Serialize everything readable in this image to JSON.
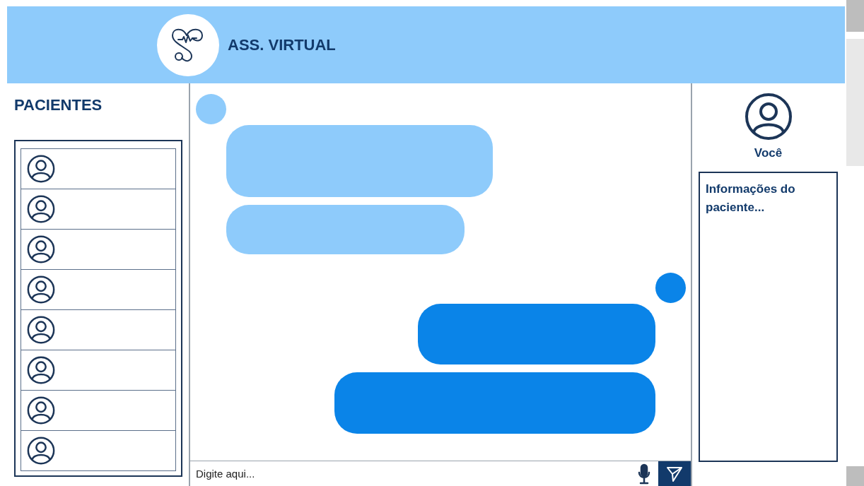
{
  "header": {
    "title": "ASS. VIRTUAL"
  },
  "patients_panel": {
    "title": "PACIENTES",
    "patients": [
      {
        "kind": "avatar"
      },
      {
        "kind": "avatar"
      },
      {
        "kind": "avatar"
      },
      {
        "kind": "avatar"
      },
      {
        "kind": "avatar"
      },
      {
        "kind": "avatar"
      },
      {
        "kind": "avatar"
      },
      {
        "kind": "avatar"
      }
    ]
  },
  "chat": {
    "messages": [
      {
        "kind": "received",
        "avatar": true
      },
      {
        "kind": "received",
        "avatar": false
      },
      {
        "kind": "sent",
        "avatar": true
      },
      {
        "kind": "sent",
        "avatar": false
      }
    ],
    "input": {
      "placeholder": "Digite aqui..."
    }
  },
  "profile_panel": {
    "name": "Você",
    "info": "Informações do paciente..."
  }
}
